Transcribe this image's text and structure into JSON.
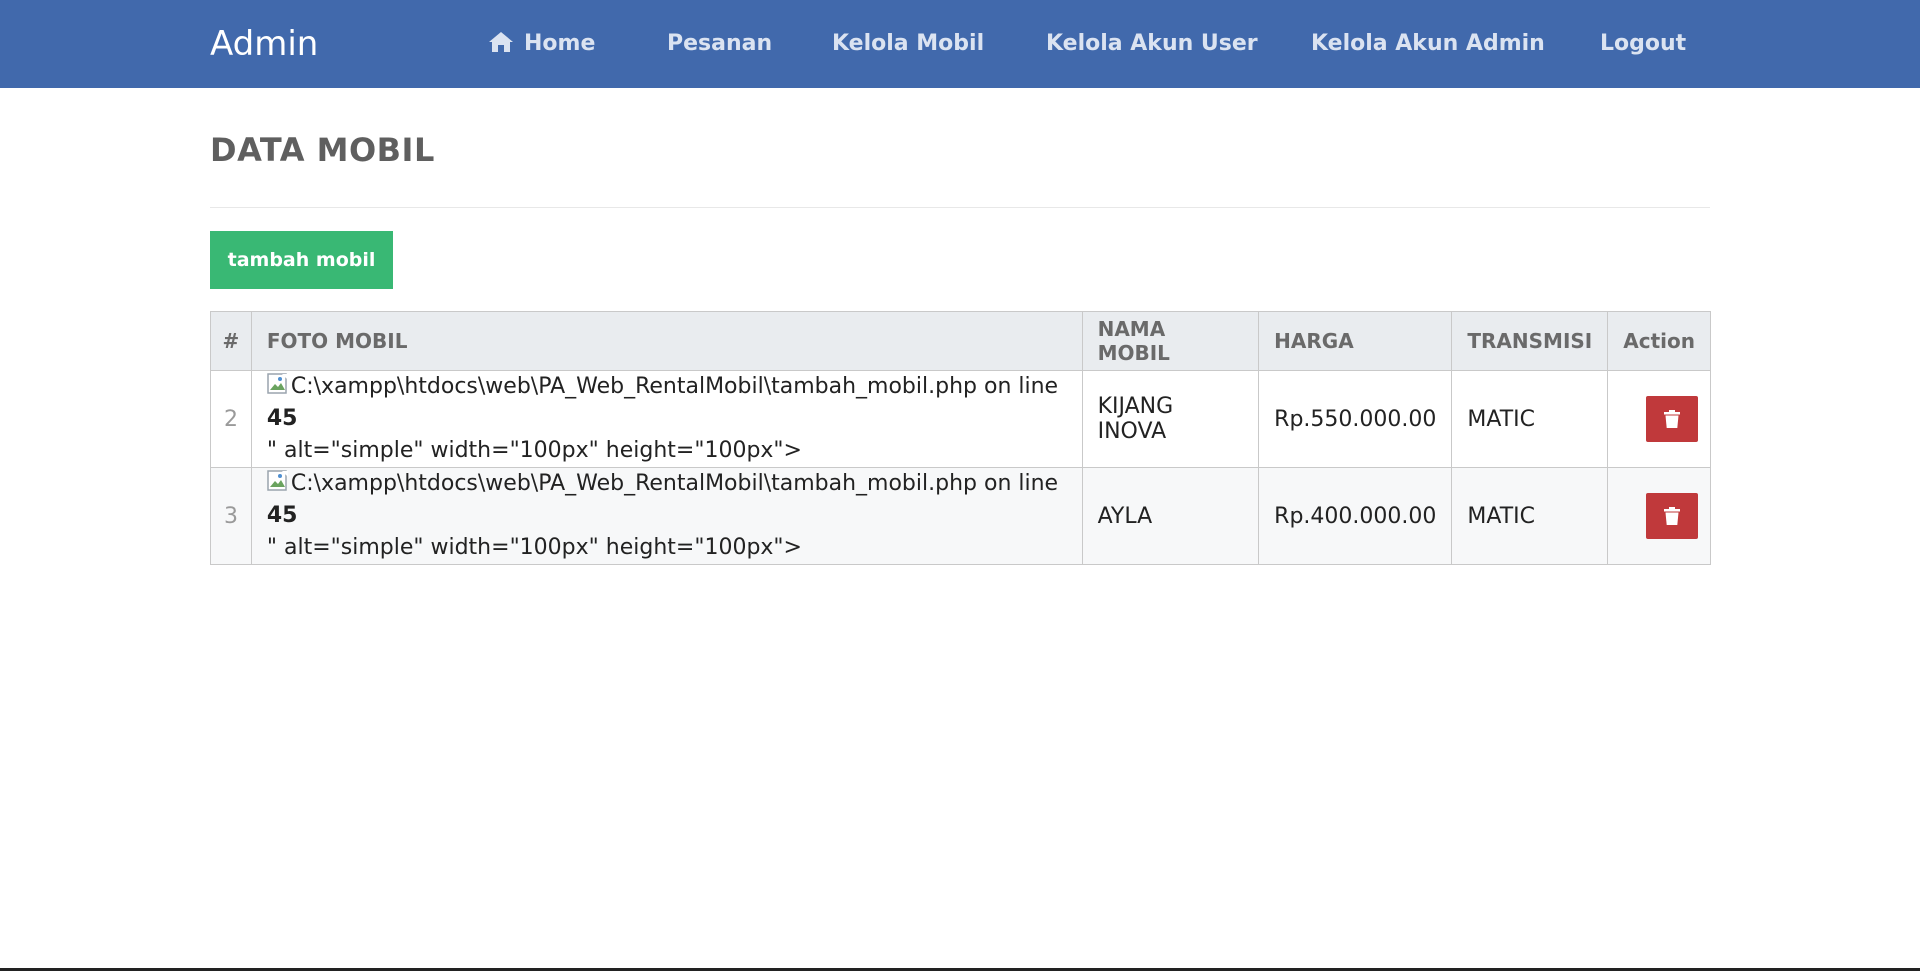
{
  "navbar": {
    "brand": "Admin",
    "items": [
      {
        "label": "Home",
        "icon": "home-icon"
      },
      {
        "label": "Pesanan"
      },
      {
        "label": "Kelola Mobil"
      },
      {
        "label": "Kelola Akun User"
      },
      {
        "label": "Kelola Akun Admin"
      },
      {
        "label": "Logout"
      }
    ],
    "background_color": "#4169ac"
  },
  "page": {
    "title": "DATA MOBIL",
    "add_button_label": "tambah mobil",
    "add_button_color": "#39b874"
  },
  "table": {
    "headers": [
      "#",
      "FOTO MOBIL",
      "NAMA MOBIL",
      "HARGA",
      "TRANSMISI",
      "Action"
    ],
    "rows": [
      {
        "num": "2",
        "foto_path": "C:\\xampp\\htdocs\\web\\PA_Web_RentalMobil\\tambah_mobil.php on line ",
        "foto_line": "45",
        "foto_tail": "\" alt=\"simple\" width=\"100px\" height=\"100px\">",
        "nama": "KIJANG INOVA",
        "harga": "Rp.550.000.00",
        "transmisi": "MATIC",
        "action_icon": "trash-icon"
      },
      {
        "num": "3",
        "foto_path": "C:\\xampp\\htdocs\\web\\PA_Web_RentalMobil\\tambah_mobil.php on line ",
        "foto_line": "45",
        "foto_tail": "\" alt=\"simple\" width=\"100px\" height=\"100px\">",
        "nama": "AYLA",
        "harga": "Rp.400.000.00",
        "transmisi": "MATIC",
        "action_icon": "trash-icon"
      }
    ],
    "delete_button_color": "#c0393b"
  }
}
